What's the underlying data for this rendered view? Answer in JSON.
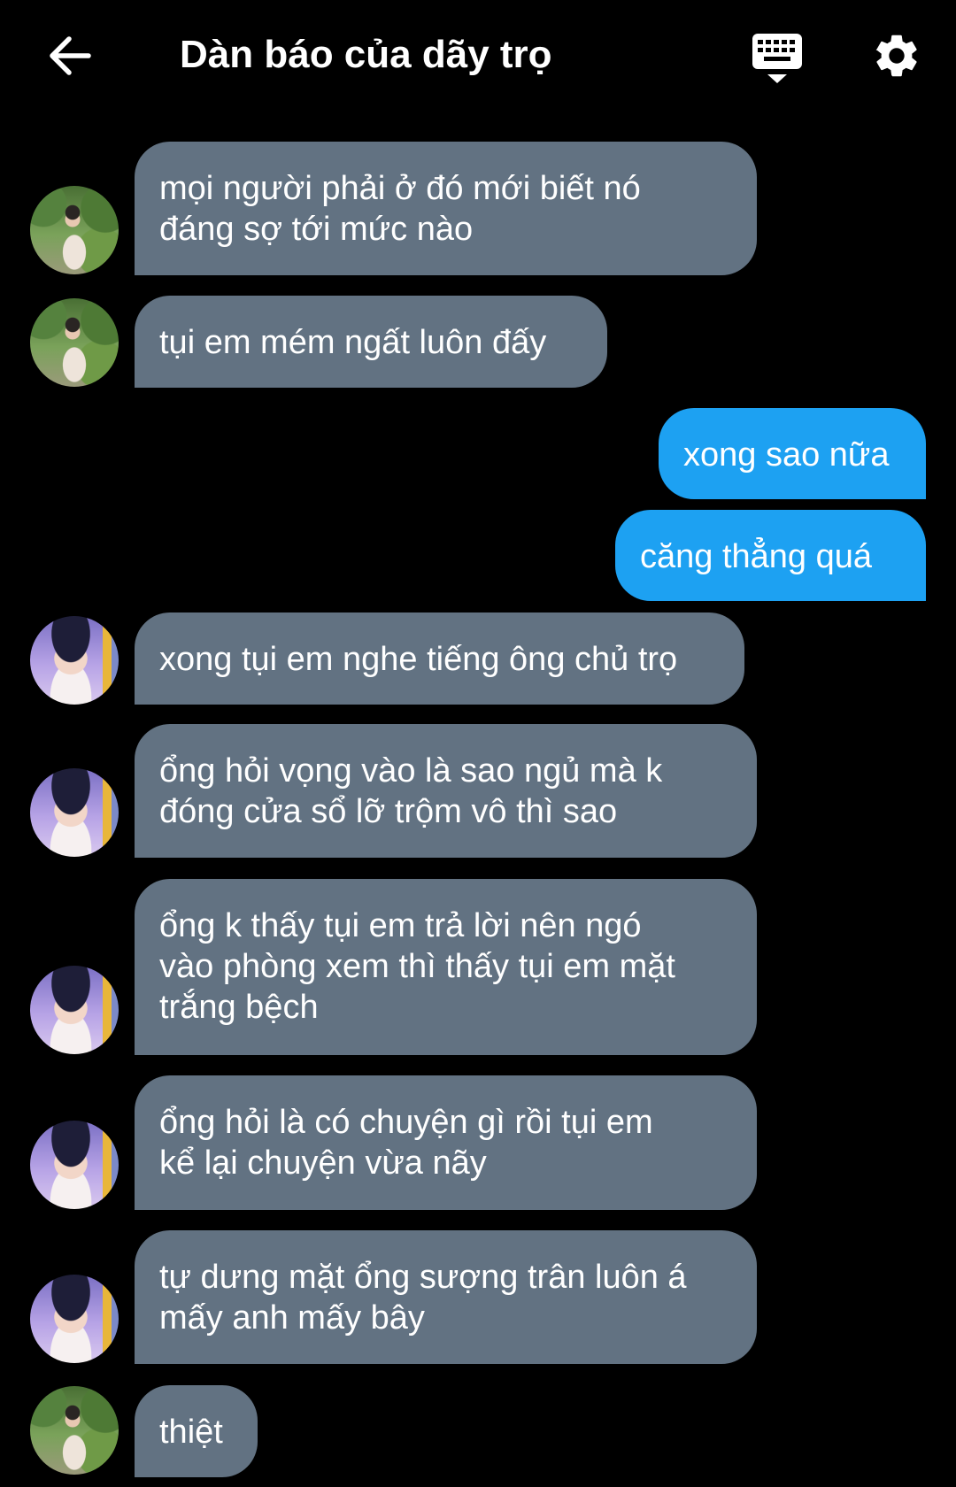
{
  "header": {
    "title": "Dàn báo của dãy trọ",
    "back_icon": "arrow-left-icon",
    "keyboard_icon": "keyboard-icon",
    "settings_icon": "gear-icon"
  },
  "colors": {
    "background": "#000000",
    "incoming_bubble": "#627282",
    "outgoing_bubble": "#1da1f2",
    "text": "#ffffff"
  },
  "messages": [
    {
      "direction": "in",
      "text": "mọi người phải ở đó mới biết nó\nđáng sợ tới mức nào"
    },
    {
      "direction": "in",
      "text": "tụi em mém ngất luôn đấy"
    },
    {
      "direction": "out",
      "text": "xong sao nữa"
    },
    {
      "direction": "out",
      "text": "căng thẳng quá"
    },
    {
      "direction": "in",
      "text": "xong tụi em nghe tiếng ông chủ trọ"
    },
    {
      "direction": "in",
      "text": "ổng hỏi vọng vào là sao ngủ mà k\nđóng cửa sổ lỡ trộm vô thì sao"
    },
    {
      "direction": "in",
      "text": "ổng k thấy tụi em trả lời nên ngó\nvào phòng xem thì thấy tụi em mặt\ntrắng bệch"
    },
    {
      "direction": "in",
      "text": "ổng hỏi là có chuyện gì rồi tụi em\nkể lại chuyện vừa nãy"
    },
    {
      "direction": "in",
      "text": "tự dưng mặt ổng sượng trân luôn á\nmấy anh mấy bây"
    },
    {
      "direction": "in",
      "text": "thiệt"
    }
  ]
}
